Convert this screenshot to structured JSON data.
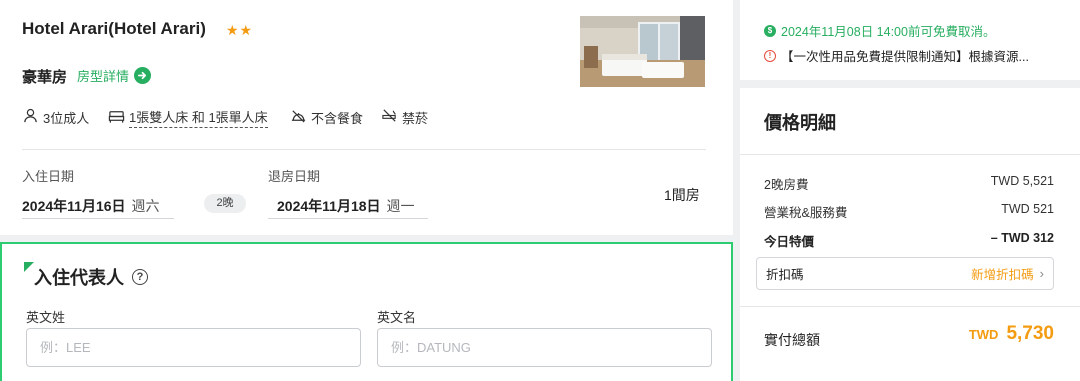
{
  "hotel": {
    "name": "Hotel Arari(Hotel Arari)",
    "stars": "★★",
    "room_name": "豪華房",
    "room_detail_link": "房型詳情"
  },
  "amenities": {
    "guests": "3位成人",
    "beds": "1張雙人床 和 1張單人床",
    "meal": "不含餐食",
    "smoking": "禁菸"
  },
  "dates": {
    "checkin_label": "入住日期",
    "checkin_date": "2024年11月16日",
    "checkin_weekday": "週六",
    "nights": "2晚",
    "checkout_label": "退房日期",
    "checkout_date": "2024年11月18日",
    "checkout_weekday": "週一",
    "rooms": "1間房"
  },
  "guest_form": {
    "title": "入住代表人",
    "help": "?",
    "last_name_label": "英文姓",
    "last_name_placeholder": "例：LEE",
    "first_name_label": "英文名",
    "first_name_placeholder": "例：DATUNG"
  },
  "policy": {
    "cancel_text": "2024年11月08日 14:00前可免費取消。",
    "notice_text": "【一次性用品免費提供限制通知】根據資源..."
  },
  "price": {
    "title": "價格明細",
    "room_fee_label": "2晚房費",
    "room_fee_value": "TWD 5,521",
    "tax_label": "營業稅&服務費",
    "tax_value": "TWD 521",
    "special_label": "今日特價",
    "special_value": "– TWD 312",
    "coupon_label": "折扣碼",
    "coupon_action": "新增折扣碼",
    "total_label": "實付總額",
    "total_currency": "TWD",
    "total_amount": "5,730"
  },
  "colors": {
    "accent_green": "#27ae60",
    "accent_orange": "#f39c12"
  }
}
